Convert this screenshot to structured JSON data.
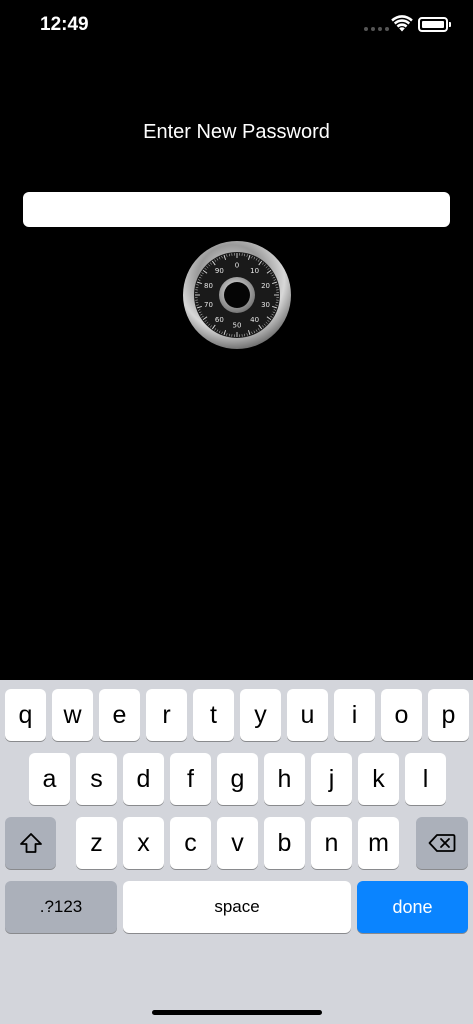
{
  "status_bar": {
    "time": "12:49",
    "icons": [
      "signal-dots-icon",
      "wifi-icon",
      "battery-icon"
    ]
  },
  "screen": {
    "title": "Enter New Password",
    "password_value": "",
    "dial_numbers": [
      "0",
      "10",
      "20",
      "30",
      "40",
      "50",
      "60",
      "70",
      "80",
      "90"
    ]
  },
  "keyboard": {
    "row1": [
      "q",
      "w",
      "e",
      "r",
      "t",
      "y",
      "u",
      "i",
      "o",
      "p"
    ],
    "row2": [
      "a",
      "s",
      "d",
      "f",
      "g",
      "h",
      "j",
      "k",
      "l"
    ],
    "row3": [
      "z",
      "x",
      "c",
      "v",
      "b",
      "n",
      "m"
    ],
    "numbers_label": ".?123",
    "space_label": "space",
    "done_label": "done",
    "shift_icon": "shift-arrow-icon",
    "delete_icon": "backspace-icon",
    "colors": {
      "background": "#d3d5db",
      "key": "#ffffff",
      "function_key": "#abb0ba",
      "done_key": "#0a84ff"
    }
  }
}
